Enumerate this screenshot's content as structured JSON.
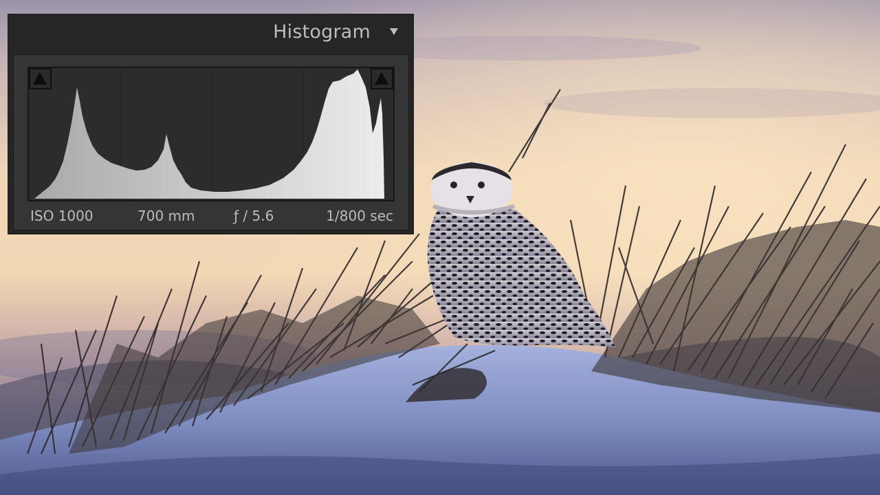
{
  "histogram_panel": {
    "title": "Histogram",
    "toggle_icon": "triangle-down-icon",
    "shadow_clip_icon": "triangle-up-icon",
    "highlight_clip_icon": "triangle-up-icon",
    "exif": {
      "iso": "ISO 1000",
      "focal_length": "700 mm",
      "aperture": "ƒ / 5.6",
      "shutter_speed": "1/800 sec"
    }
  },
  "photo": {
    "subject": "snowy-owl",
    "colors": {
      "sky_top": "#8b89a6",
      "sky_glow": "#f4d9b0",
      "snow": "#8c9acb",
      "grass": "#3a3534"
    }
  }
}
